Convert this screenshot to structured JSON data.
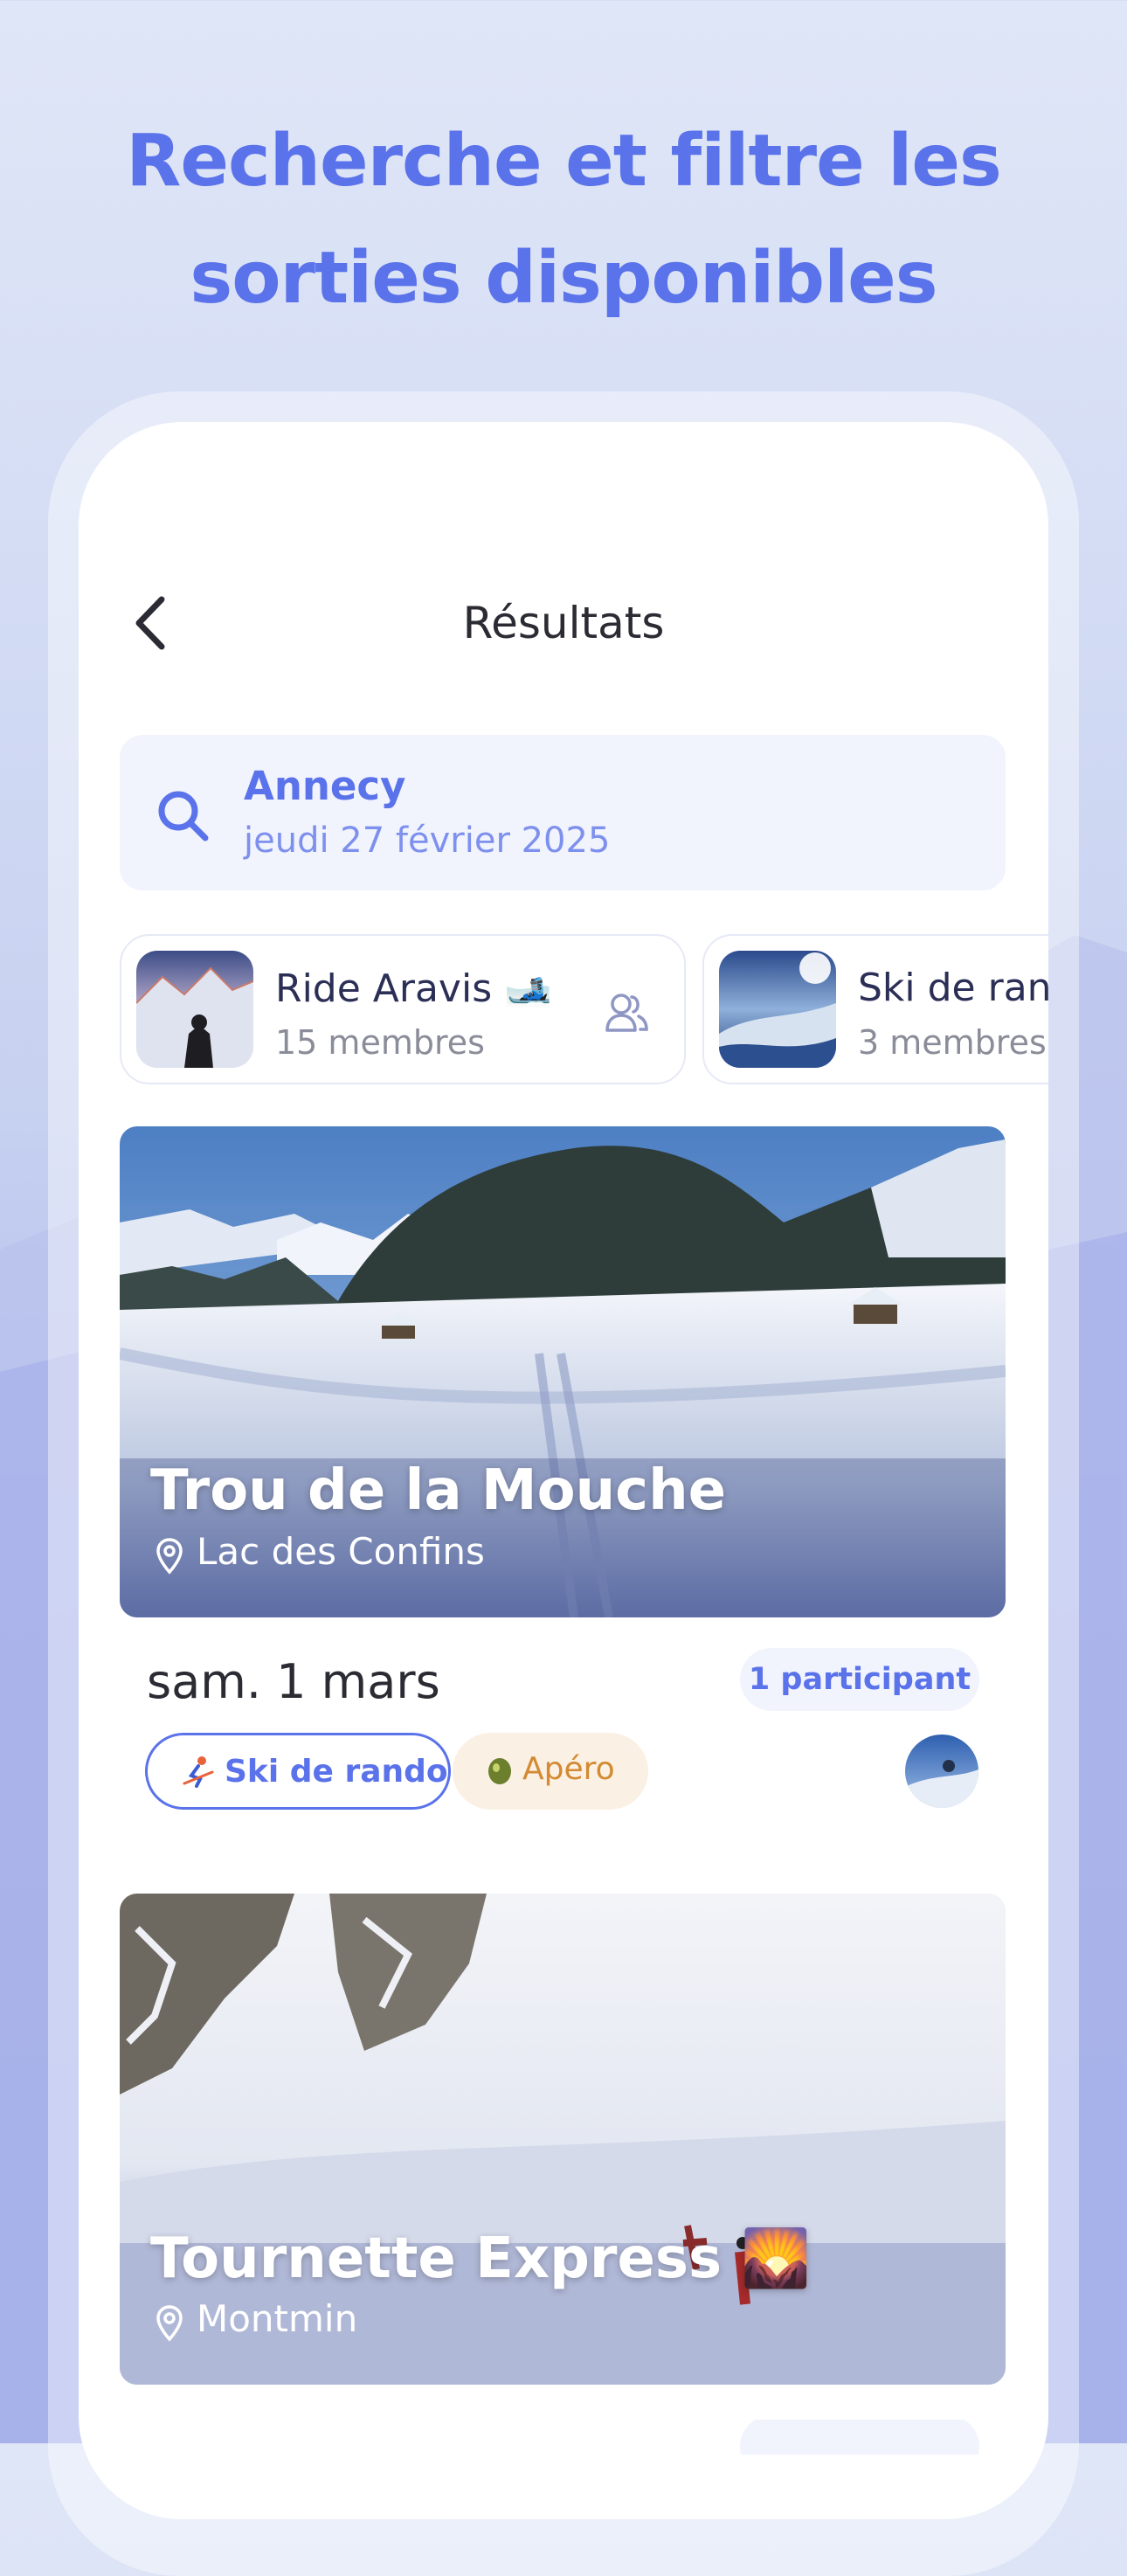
{
  "headline": {
    "line1": "Recherche et filtre les",
    "line2": "sorties disponibles"
  },
  "colors": {
    "accent": "#5a72ea",
    "apero": "#d38a32",
    "text_dark": "#2b2b33"
  },
  "header": {
    "title": "Résultats",
    "back_icon": "chevron-left-icon"
  },
  "search": {
    "city": "Annecy",
    "date": "jeudi 27 février 2025",
    "icon": "search-icon"
  },
  "groups": [
    {
      "name": "Ride Aravis 🎿",
      "members": "15 membres"
    },
    {
      "name": "Ski de ran",
      "members": "3 membres"
    }
  ],
  "events": [
    {
      "title": "Trou de la Mouche",
      "location": "Lac des Confins",
      "date": "sam. 1 mars",
      "participants": "1 participant",
      "tags": [
        {
          "label": "Ski de rando",
          "icon": "skier-icon"
        },
        {
          "label": "Apéro",
          "icon": "olive-icon"
        }
      ]
    },
    {
      "title": "Tournette Express 🌄",
      "location": "Montmin"
    }
  ]
}
